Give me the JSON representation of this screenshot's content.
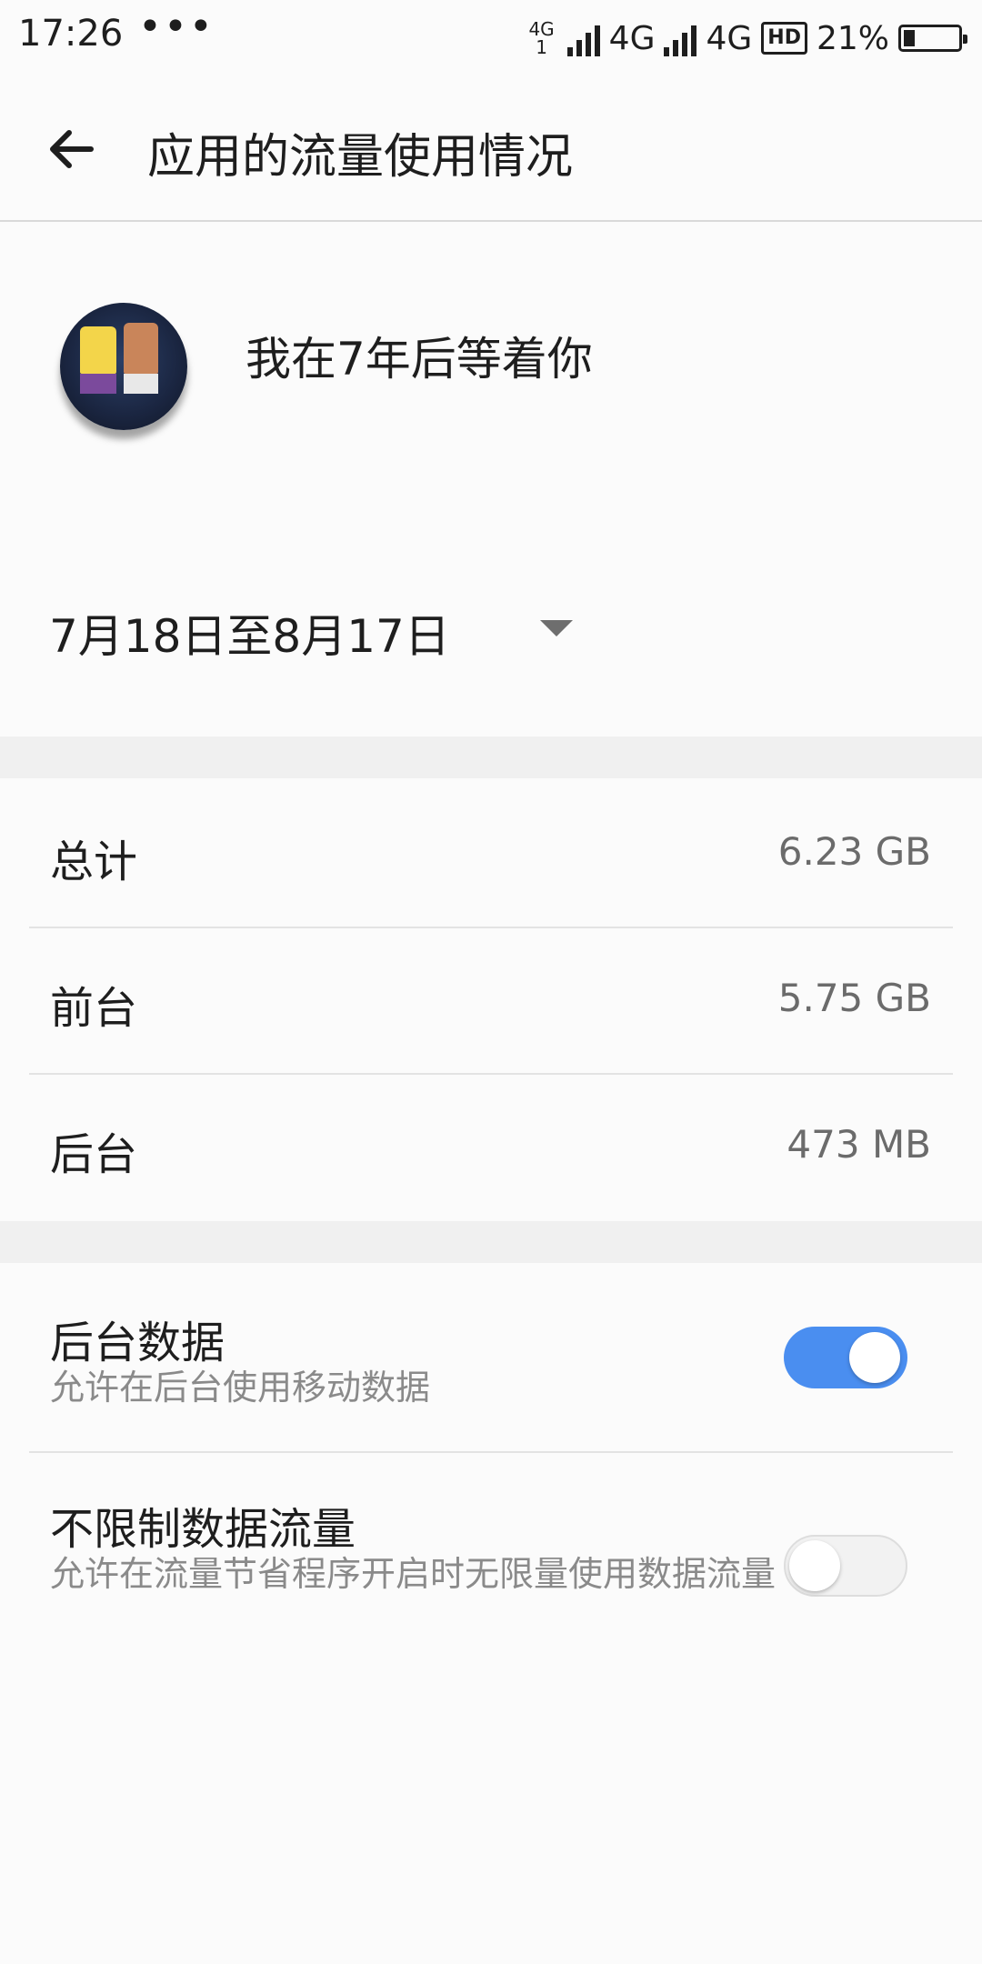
{
  "status_bar": {
    "time": "17:26",
    "dots": "•••",
    "net_small_top": "4G",
    "net_small_bottom": "1",
    "net1": "4G",
    "net2": "4G",
    "hd": "HD",
    "battery_percent": "21%",
    "battery_level": 0.21
  },
  "app_bar": {
    "title": "应用的流量使用情况",
    "back_icon": "arrow-left-icon"
  },
  "app": {
    "name": "我在7年后等着你",
    "icon_text": "我在7年后等着你",
    "icon": "app-icon"
  },
  "date_range": {
    "label": "7月18日至8月17日",
    "icon": "dropdown-triangle-icon"
  },
  "usage": [
    {
      "label": "总计",
      "value": "6.23 GB"
    },
    {
      "label": "前台",
      "value": "5.75 GB"
    },
    {
      "label": "后台",
      "value": "473 MB"
    }
  ],
  "settings": [
    {
      "title": "后台数据",
      "subtitle": "允许在后台使用移动数据",
      "enabled": true
    },
    {
      "title": "不限制数据流量",
      "subtitle": "允许在流量节省程序开启时无限量使用数据流量",
      "enabled": false
    }
  ],
  "colors": {
    "toggle_on": "#4a8ef0",
    "background": "#fbfbfb",
    "section_gap": "#f0f0f0"
  }
}
